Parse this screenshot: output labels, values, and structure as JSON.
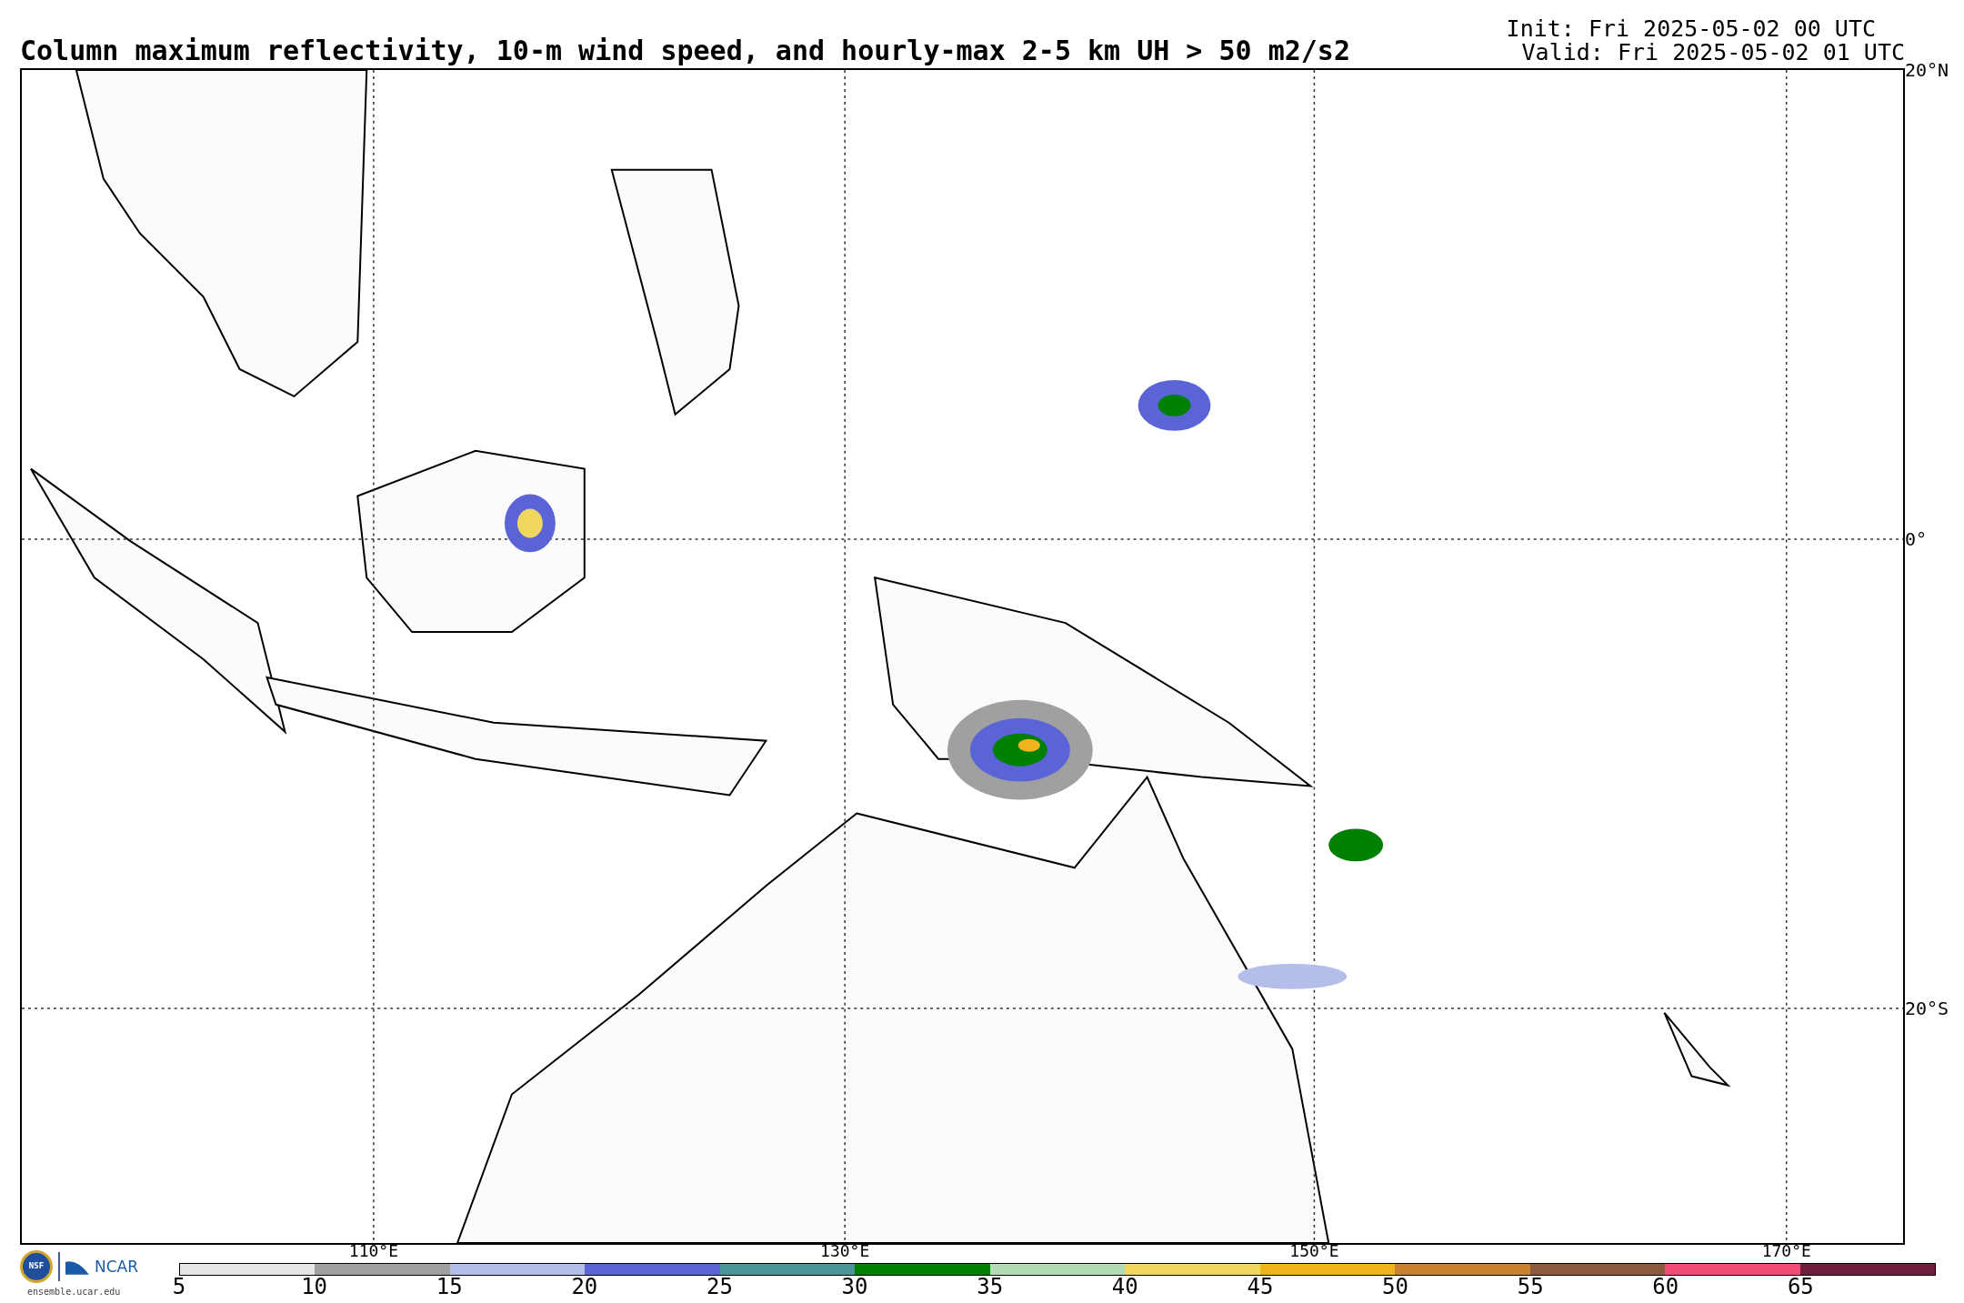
{
  "title": "Column maximum reflectivity, 10-m wind speed, and hourly-max 2-5 km UH > 50 m2/s2",
  "init": "Init: Fri 2025-05-02 00 UTC",
  "valid": "Valid: Fri 2025-05-02 01 UTC",
  "map": {
    "lat_labels": [
      "20°N",
      "0°",
      "20°S"
    ],
    "lon_labels": [
      "110°E",
      "130°E",
      "150°E",
      "170°E"
    ]
  },
  "logo": {
    "seal": "NSF",
    "name": "NCAR",
    "url": "ensemble.ucar.edu"
  },
  "colorbar": {
    "ticks": [
      "5",
      "10",
      "15",
      "20",
      "25",
      "30",
      "35",
      "40",
      "45",
      "50",
      "55",
      "60",
      "65"
    ],
    "segments": [
      {
        "color": "#e6e6e6"
      },
      {
        "color": "#a0a0a0"
      },
      {
        "color": "#b4bee8"
      },
      {
        "color": "#5a64d6"
      },
      {
        "color": "#4a9696"
      },
      {
        "color": "#008000"
      },
      {
        "color": "#b4dcb4"
      },
      {
        "color": "#f0d860"
      },
      {
        "color": "#f0b41e"
      },
      {
        "color": "#c8822d"
      },
      {
        "color": "#8c5a3c"
      },
      {
        "color": "#f04c78"
      },
      {
        "color": "#6e1e3c"
      }
    ]
  }
}
